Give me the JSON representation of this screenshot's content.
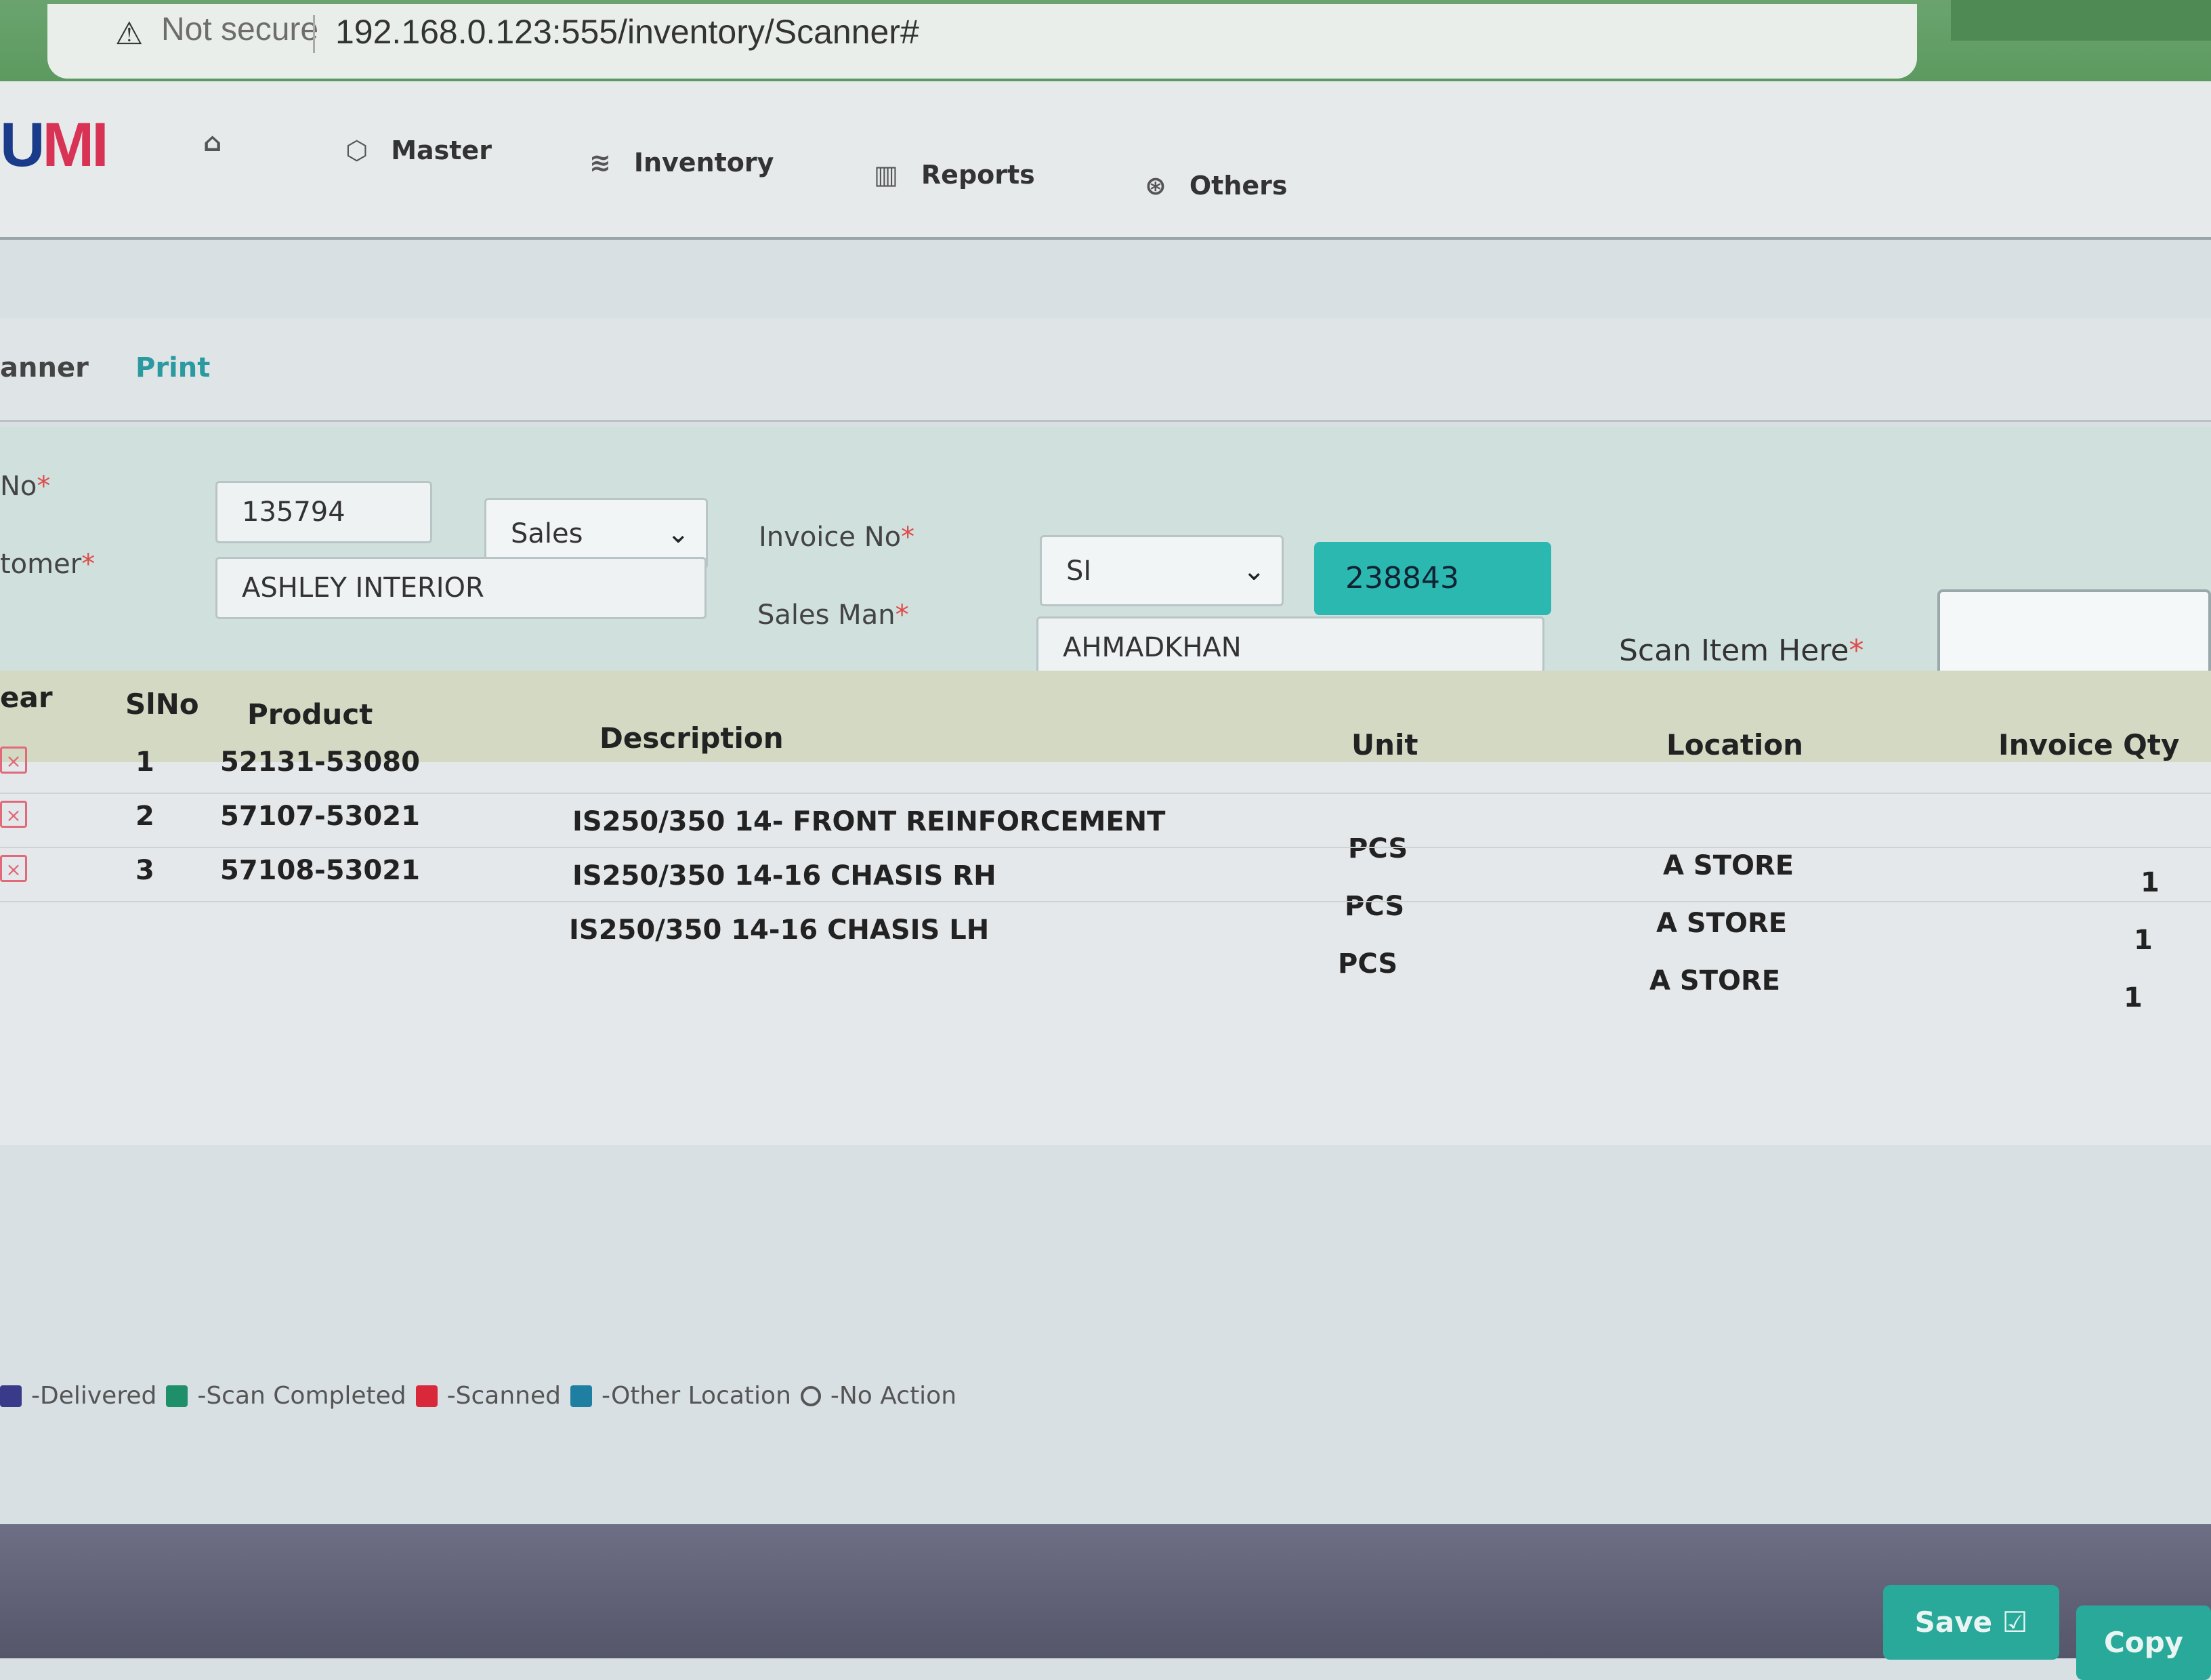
{
  "browser": {
    "security_label": "Not secure",
    "url": "192.168.0.123:555/inventory/Scanner#"
  },
  "app": {
    "logo_part1": "U",
    "logo_part2": "MI"
  },
  "nav": {
    "master": "Master",
    "inventory": "Inventory",
    "reports": "Reports",
    "others": "Others"
  },
  "tabs": {
    "scanner": "anner",
    "print": "Print"
  },
  "form": {
    "no_label": "No",
    "no_value": "135794",
    "type_value": "Sales",
    "customer_label": "tomer",
    "customer_value": "ASHLEY INTERIOR",
    "invoice_label": "Invoice No",
    "invoice_prefix": "SI",
    "invoice_number": "238843",
    "salesman_label": "Sales Man",
    "salesman_value": "AHMADKHAN",
    "scan_label": "Scan Item Here",
    "required_mark": "*"
  },
  "table": {
    "headers": {
      "clear": "ear",
      "slno": "SlNo",
      "product": "Product",
      "description": "Description",
      "unit": "Unit",
      "location": "Location",
      "invoice_qty": "Invoice Qty"
    },
    "rows": [
      {
        "slno": "1",
        "product": "52131-53080",
        "description": "IS250/350 14- FRONT REINFORCEMENT",
        "unit": "PCS",
        "location": "A STORE",
        "qty": "1"
      },
      {
        "slno": "2",
        "product": "57107-53021",
        "description": "IS250/350 14-16 CHASIS RH",
        "unit": "PCS",
        "location": "A STORE",
        "qty": "1"
      },
      {
        "slno": "3",
        "product": "57108-53021",
        "description": "IS250/350 14-16 CHASIS LH",
        "unit": "PCS",
        "location": "A STORE",
        "qty": "1"
      }
    ]
  },
  "legend": {
    "delivered": "-Delivered",
    "scan_completed": "-Scan Completed",
    "scanned": "-Scanned",
    "other_location": "-Other Location",
    "no_action": "-No Action",
    "colors": {
      "delivered": "#3a3a8a",
      "scan_completed": "#1f8f6a",
      "scanned": "#d8283a",
      "other_location": "#1f7fa0"
    }
  },
  "buttons": {
    "save": "Save",
    "copy": "Copy"
  },
  "colors": {
    "accent": "#2bb8b0",
    "button": "#28a99a"
  }
}
